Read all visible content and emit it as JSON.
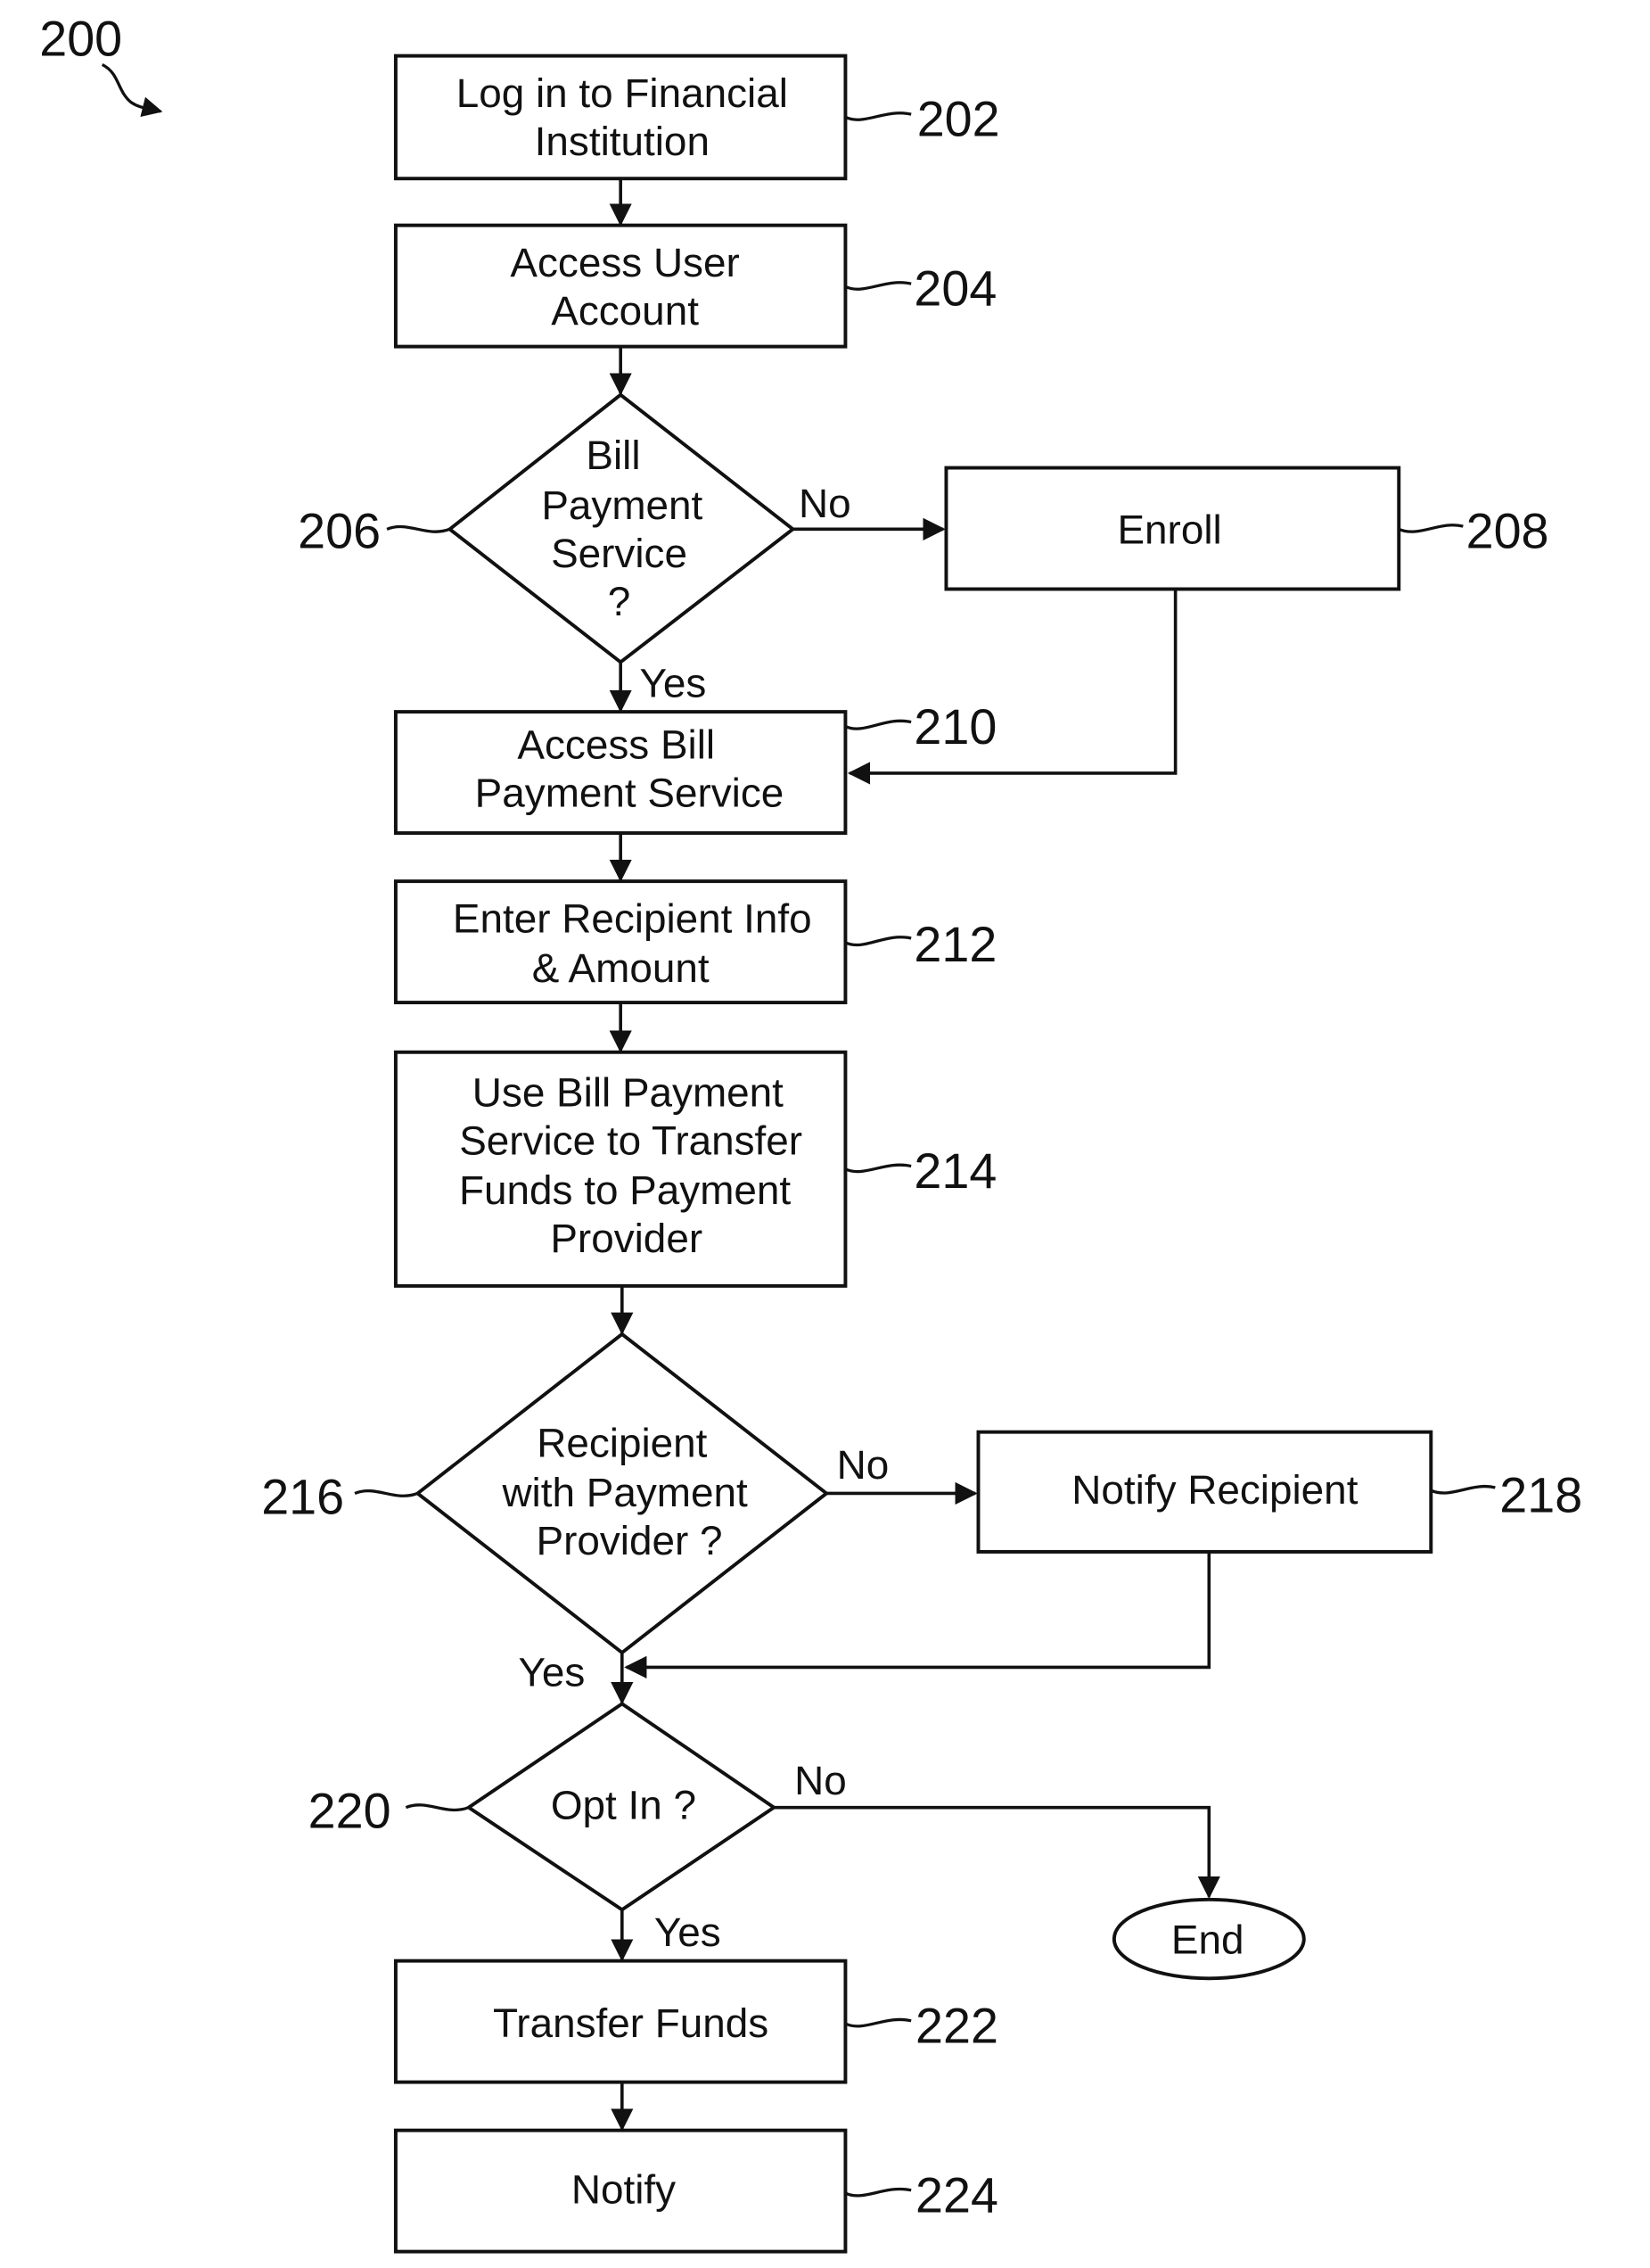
{
  "figure": {
    "number": "200",
    "colors": {
      "ink": "#111111",
      "background": "#ffffff"
    }
  },
  "nodes": {
    "n202": {
      "ref": "202",
      "type": "process",
      "lines": [
        "Log in to Financial",
        "Institution"
      ]
    },
    "n204": {
      "ref": "204",
      "type": "process",
      "lines": [
        "Access User",
        "Account"
      ]
    },
    "n206": {
      "ref": "206",
      "type": "decision",
      "lines": [
        "Bill",
        "Payment",
        "Service",
        "?"
      ]
    },
    "n208": {
      "ref": "208",
      "type": "process",
      "lines": [
        "Enroll"
      ]
    },
    "n210": {
      "ref": "210",
      "type": "process",
      "lines": [
        "Access Bill",
        "Payment Service"
      ]
    },
    "n212": {
      "ref": "212",
      "type": "process",
      "lines": [
        "Enter Recipient Info",
        "& Amount"
      ]
    },
    "n214": {
      "ref": "214",
      "type": "process",
      "lines": [
        "Use Bill Payment",
        "Service to Transfer",
        "Funds to Payment",
        "Provider"
      ]
    },
    "n216": {
      "ref": "216",
      "type": "decision",
      "lines": [
        "Recipient",
        "with Payment",
        "Provider ?"
      ]
    },
    "n218": {
      "ref": "218",
      "type": "process",
      "lines": [
        "Notify Recipient"
      ]
    },
    "n220": {
      "ref": "220",
      "type": "decision",
      "lines": [
        "Opt In ?"
      ]
    },
    "end": {
      "type": "terminator",
      "lines": [
        "End"
      ]
    },
    "n222": {
      "ref": "222",
      "type": "process",
      "lines": [
        "Transfer Funds"
      ]
    },
    "n224": {
      "ref": "224",
      "type": "process",
      "lines": [
        "Notify"
      ]
    }
  },
  "edges": [
    {
      "from": "202",
      "to": "204",
      "label": ""
    },
    {
      "from": "204",
      "to": "206",
      "label": ""
    },
    {
      "from": "206",
      "to": "208",
      "label": "No"
    },
    {
      "from": "206",
      "to": "210",
      "label": "Yes"
    },
    {
      "from": "208",
      "to": "210",
      "label": ""
    },
    {
      "from": "210",
      "to": "212",
      "label": ""
    },
    {
      "from": "212",
      "to": "214",
      "label": ""
    },
    {
      "from": "214",
      "to": "216",
      "label": ""
    },
    {
      "from": "216",
      "to": "218",
      "label": "No"
    },
    {
      "from": "216",
      "to": "220",
      "label": "Yes"
    },
    {
      "from": "218",
      "to": "220",
      "label": ""
    },
    {
      "from": "220",
      "to": "End",
      "label": "No"
    },
    {
      "from": "220",
      "to": "222",
      "label": "Yes"
    },
    {
      "from": "222",
      "to": "224",
      "label": ""
    }
  ],
  "labels": {
    "yes": "Yes",
    "no": "No"
  }
}
